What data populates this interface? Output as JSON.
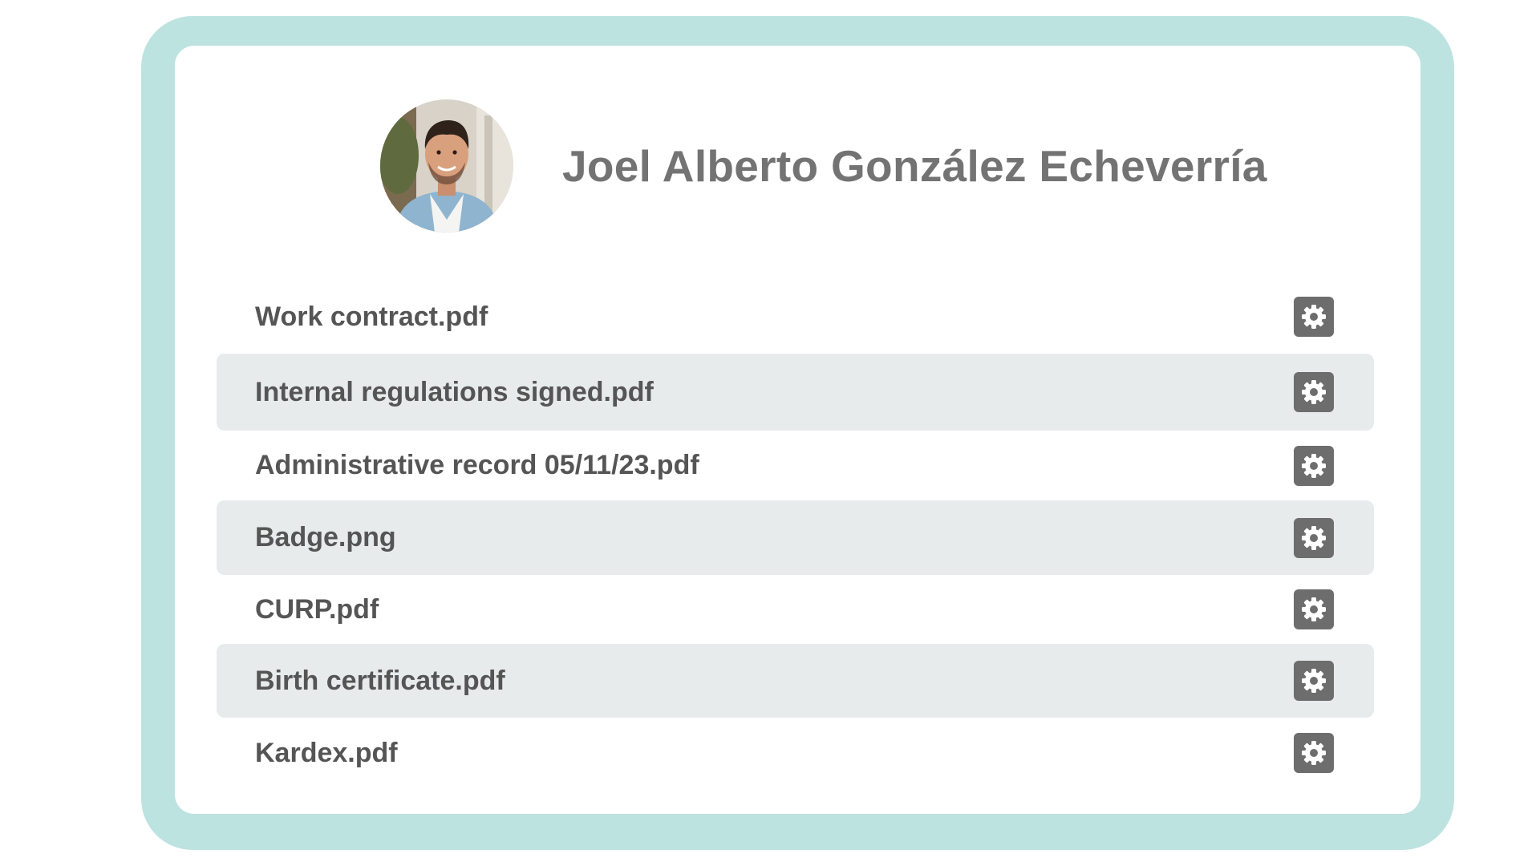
{
  "profile": {
    "name": "Joel Alberto González Echeverría",
    "avatar_icon": "person-photo"
  },
  "colors": {
    "frame": "#bce3e0",
    "card": "#ffffff",
    "row_shade": "#e8ebec",
    "name_text": "#737373",
    "file_text": "#555555",
    "gear_button": "#6d6d6d"
  },
  "files": [
    {
      "name": "Work contract.pdf",
      "action_icon": "gear-icon"
    },
    {
      "name": "Internal regulations signed.pdf",
      "action_icon": "gear-icon"
    },
    {
      "name": "Administrative record 05/11/23.pdf",
      "action_icon": "gear-icon"
    },
    {
      "name": "Badge.png",
      "action_icon": "gear-icon"
    },
    {
      "name": "CURP.pdf",
      "action_icon": "gear-icon"
    },
    {
      "name": "Birth certificate.pdf",
      "action_icon": "gear-icon"
    },
    {
      "name": "Kardex.pdf",
      "action_icon": "gear-icon"
    }
  ]
}
